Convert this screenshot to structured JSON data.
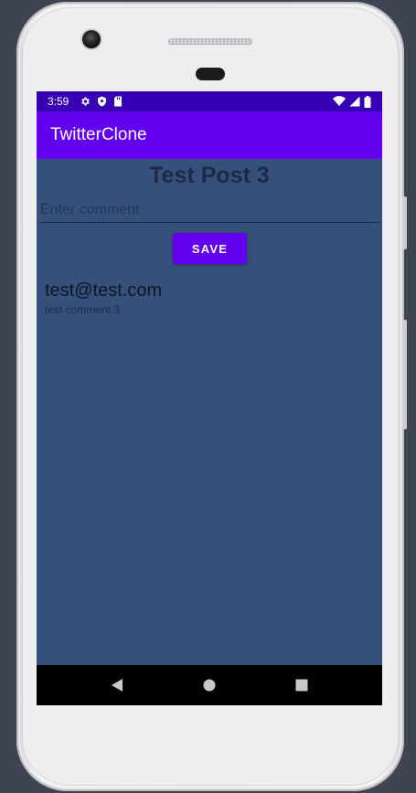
{
  "status_bar": {
    "time": "3:59",
    "left_icons": [
      "gear-icon",
      "shield-icon",
      "sd-card-icon"
    ],
    "right_icons": [
      "wifi-icon",
      "signal-icon",
      "battery-icon"
    ]
  },
  "app_bar": {
    "title": "TwitterClone"
  },
  "post": {
    "title": "Test Post 3"
  },
  "comment_form": {
    "input_placeholder": "Enter comment",
    "input_value": "",
    "save_label": "SAVE"
  },
  "comments": [
    {
      "author": "test@test.com",
      "text": "test comment 3"
    }
  ],
  "nav_bar": {
    "buttons": [
      "back-icon",
      "home-icon",
      "recents-icon"
    ]
  },
  "colors": {
    "status_bar": "#3700b3",
    "app_bar": "#6200ee",
    "screen_background": "#36507c",
    "accent": "#6200ee"
  }
}
